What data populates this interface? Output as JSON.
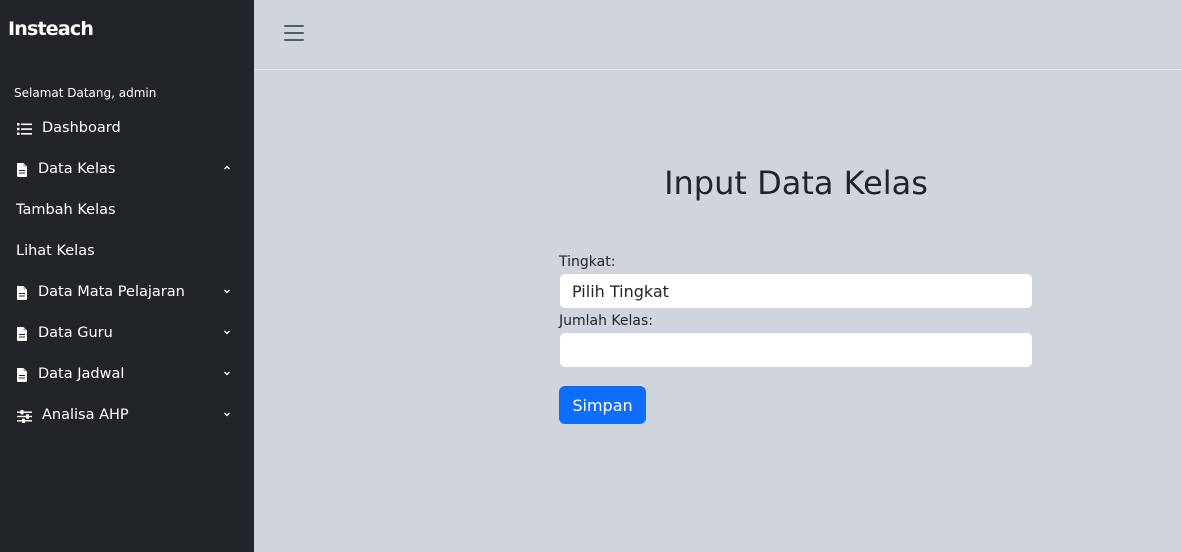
{
  "sidebar": {
    "brand": "Insteach",
    "welcome": "Selamat Datang, admin",
    "items": [
      {
        "label": "Dashboard",
        "icon": "list-icon"
      },
      {
        "label": "Data Kelas",
        "icon": "file-icon",
        "expanded": true,
        "children": [
          {
            "label": "Tambah Kelas"
          },
          {
            "label": "Lihat Kelas"
          }
        ]
      },
      {
        "label": "Data Mata Pelajaran",
        "icon": "file-icon"
      },
      {
        "label": "Data Guru",
        "icon": "file-icon"
      },
      {
        "label": "Data Jadwal",
        "icon": "file-icon"
      },
      {
        "label": "Analisa AHP",
        "icon": "sliders-icon"
      }
    ]
  },
  "topbar": {
    "menu_icon": "hamburger-icon"
  },
  "form": {
    "title": "Input Data Kelas",
    "tingkat_label": "Tingkat:",
    "tingkat_value": "Pilih Tingkat",
    "jumlah_label": "Jumlah Kelas:",
    "jumlah_value": "",
    "submit_label": "Simpan"
  },
  "colors": {
    "sidebar_bg": "#212529",
    "page_bg": "#d0d4dc",
    "primary": "#0d6efd"
  }
}
